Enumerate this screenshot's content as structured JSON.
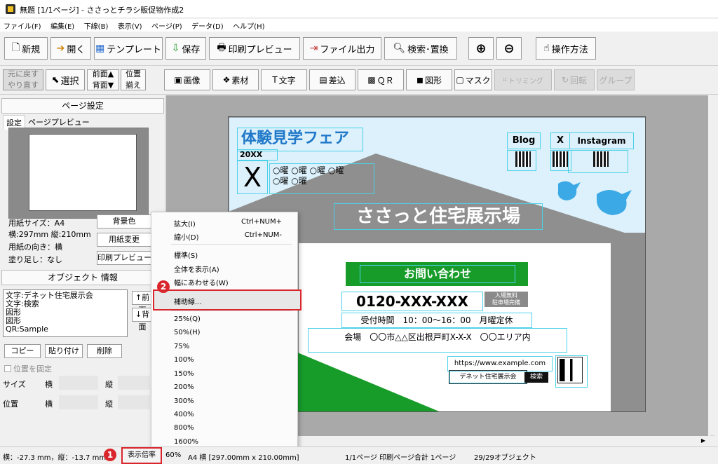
{
  "window": {
    "title": "無題 [1/1ページ] - ささっとチラシ販促物作成2"
  },
  "menu": [
    "ファイル(F)",
    "編集(E)",
    "下線(B)",
    "表示(V)",
    "ページ(P)",
    "データ(D)",
    "ヘルプ(H)"
  ],
  "toolbar": {
    "new": "新規",
    "open": "開く",
    "template": "テンプレート",
    "save": "保存",
    "print_preview": "印刷プレビュー",
    "file_output": "ファイル出力",
    "search_replace": "検索･置換",
    "howto": "操作方法"
  },
  "toolbar2": {
    "undo": "元に戻す",
    "redo": "やり直す",
    "select": "選択",
    "front": "前面▲",
    "back": "背面▼",
    "align1": "位置",
    "align2": "揃え",
    "image": "画像",
    "material": "素材",
    "text": "文字",
    "merge": "差込",
    "qr": "ＱＲ",
    "shape": "図形",
    "mask": "マスク",
    "trim": "トリミング",
    "rotate": "回転",
    "group": "グループ"
  },
  "left": {
    "page_settings": "ページ設定",
    "tab_settings": "設定",
    "tab_preview": "ページプレビュー",
    "paper_size": "用紙サイズ：A4",
    "dims": "横:297mm 縦:210mm",
    "orientation": "用紙の向き：横",
    "bleed": "塗り足し：なし",
    "bg_color": "背景色",
    "change_paper": "用紙変更",
    "print_preview": "印刷プレビュー",
    "obj_info": "オブジェクト 情報",
    "objects": [
      "文字:デネット住宅展示会",
      "文字:検索",
      "図形",
      "図形",
      "QR:Sample"
    ],
    "front_btn": "↑前面",
    "back_btn": "↓背面",
    "copy": "コピー",
    "paste": "貼り付け",
    "delete": "削除",
    "lock": "位置を固定",
    "size": "サイズ",
    "pos": "位置",
    "w": "横",
    "h": "縦"
  },
  "flyer": {
    "title": "体験見学フェア",
    "year": "20XX",
    "month": "X",
    "days1": "○曜 ○曜 ○曜 ○曜",
    "days2": "○曜 ○曜",
    "blog": "Blog",
    "x": "X",
    "instagram": "Instagram",
    "venue_name": "ささっと住宅展示場",
    "contact": "お問い合わせ",
    "phone": "0120-XXX-XXX",
    "badge1": "入場無料",
    "badge2": "駐車場完備",
    "hours": "受付時間　10：00～16：00　月曜定休",
    "address": "会場　〇〇市△△区出根戸町X-X-X　〇〇エリア内",
    "url": "https://www.example.com",
    "search_text": "デネット住宅展示会",
    "search_btn": "検索",
    "colors": {
      "sky": "#dcf1fb",
      "house": "#8f8f8f",
      "green": "#179c2a",
      "title_blue": "#1f78c8"
    }
  },
  "context_menu": {
    "items": [
      {
        "label": "拡大(I)",
        "shortcut": "Ctrl+NUM+"
      },
      {
        "label": "縮小(D)",
        "shortcut": "Ctrl+NUM-"
      },
      {
        "label": "標準(S)",
        "shortcut": ""
      },
      {
        "label": "全体を表示(A)",
        "shortcut": ""
      },
      {
        "label": "幅にあわせる(W)",
        "shortcut": ""
      },
      {
        "label": "補助線...",
        "shortcut": ""
      }
    ],
    "zooms": [
      "25%(Q)",
      "50%(H)",
      "75%",
      "100%",
      "150%",
      "200%",
      "300%",
      "400%",
      "800%",
      "1600%"
    ]
  },
  "status": {
    "coords": "横：-27.3 mm，縦：-13.7 mm",
    "zoom_btn": "表示倍率",
    "zoom_val": "60%",
    "paper": "A4 横 [297.00mm x 210.00mm]",
    "pages": "1/1ページ 印刷ページ合計 1ページ",
    "objects": "29/29オブジェクト"
  },
  "callouts": {
    "one": "1",
    "two": "2"
  }
}
